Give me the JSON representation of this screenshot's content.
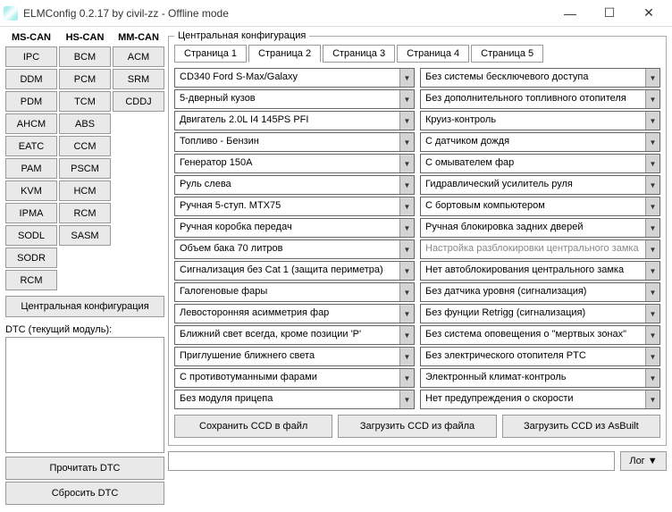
{
  "title": "ELMConfig 0.2.17 by civil-zz - Offline mode",
  "columns": {
    "mscan": {
      "title": "MS-CAN",
      "items": [
        "IPC",
        "DDM",
        "PDM",
        "AHCM",
        "EATC",
        "PAM",
        "KVM",
        "IPMA",
        "SODL",
        "SODR",
        "RCM"
      ]
    },
    "hscan": {
      "title": "HS-CAN",
      "items": [
        "BCM",
        "PCM",
        "TCM",
        "ABS",
        "CCM",
        "PSCM",
        "HCM",
        "RCM",
        "SASM"
      ]
    },
    "mmcan": {
      "title": "MM-CAN",
      "items": [
        "ACM",
        "SRM",
        "CDDJ"
      ]
    }
  },
  "central_cfg_btn": "Центральная конфигурация",
  "dtc_label": "DTC (текущий модуль):",
  "read_dtc": "Прочитать DTC",
  "clear_dtc": "Сбросить DTC",
  "groupbox": "Центральная конфигурация",
  "tabs": [
    "Страница 1",
    "Страница 2",
    "Страница 3",
    "Страница 4",
    "Страница 5"
  ],
  "active_tab": 1,
  "left_combos": [
    "CD340 Ford S-Max/Galaxy",
    "5-дверный кузов",
    "Двигатель 2.0L I4 145PS PFI",
    "Топливо - Бензин",
    "Генератор 150А",
    "Руль слева",
    "Ручная 5-ступ. MTX75",
    "Ручная коробка передач",
    "Объем бака 70 литров",
    "Сигнализация без Cat 1 (защита периметра)",
    "Галогеновые фары",
    "Левосторонняя асимметрия фар",
    "Ближний свет всегда, кроме позиции 'P'",
    "Приглушение ближнего света",
    "С противотуманными фарами",
    "Без модуля прицепа"
  ],
  "right_combos": [
    "Без системы бесключевого доступа",
    "Без дополнительного топливного отопителя",
    "Круиз-контроль",
    "С датчиком дождя",
    "С омывателем фар",
    "Гидравлический усилитель руля",
    "С бортовым компьютером",
    "Ручная блокировка задних дверей",
    "Настройка разблокировки центрального замка",
    "Нет автоблокирования центрального замка",
    "Без датчика уровня (сигнализация)",
    "Без фунции Retrigg (сигнализация)",
    "Без система оповещения о \"мертвых зонах\"",
    "Без электрического отопителя PTC",
    "Электронный климат-контроль",
    "Нет предупреждения о скорости"
  ],
  "right_disabled_index": 8,
  "save_ccd": "Сохранить CCD в файл",
  "load_ccd_file": "Загрузить CCD из файла",
  "load_ccd_asbuilt": "Загрузить CCD из AsBuilt",
  "log_btn": "Лог ▼"
}
